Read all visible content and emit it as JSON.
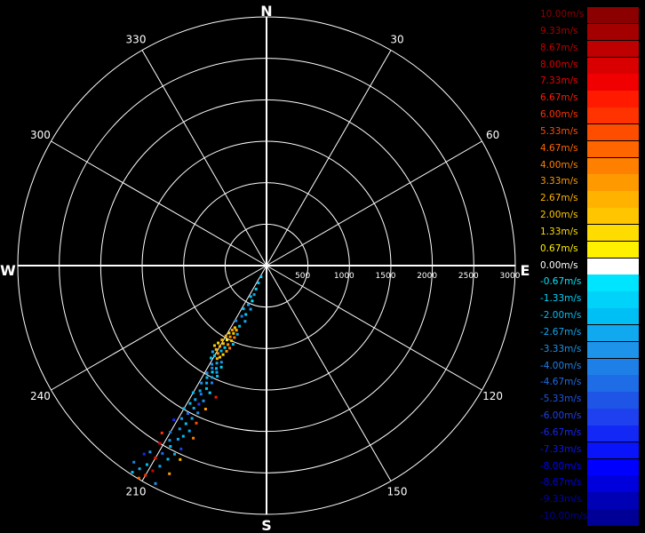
{
  "chart_data": {
    "type": "scatter",
    "projection": "polar",
    "compass": {
      "north": "N",
      "east": "E",
      "south": "S",
      "west": "W"
    },
    "angle_labels": [
      "30",
      "60",
      "120",
      "150",
      "210",
      "240",
      "300",
      "330"
    ],
    "range_labels": [
      "500",
      "1000",
      "1500",
      "2000",
      "2500",
      "3000"
    ],
    "range_max": 3000,
    "grid": true,
    "legend_position": "right",
    "legend": [
      {
        "label": "10.00m/s",
        "value": 10.0,
        "color": "#8b0000"
      },
      {
        "label": "9.33m/s",
        "value": 9.33,
        "color": "#a50000"
      },
      {
        "label": "8.67m/s",
        "value": 8.67,
        "color": "#bf0000"
      },
      {
        "label": "8.00m/s",
        "value": 8.0,
        "color": "#d80000"
      },
      {
        "label": "7.33m/s",
        "value": 7.33,
        "color": "#f00000"
      },
      {
        "label": "6.67m/s",
        "value": 6.67,
        "color": "#ff1a00"
      },
      {
        "label": "6.00m/s",
        "value": 6.0,
        "color": "#ff3300"
      },
      {
        "label": "5.33m/s",
        "value": 5.33,
        "color": "#ff4d00"
      },
      {
        "label": "4.67m/s",
        "value": 4.67,
        "color": "#ff6600"
      },
      {
        "label": "4.00m/s",
        "value": 4.0,
        "color": "#ff7f00"
      },
      {
        "label": "3.33m/s",
        "value": 3.33,
        "color": "#ff9900"
      },
      {
        "label": "2.67m/s",
        "value": 2.67,
        "color": "#ffb300"
      },
      {
        "label": "2.00m/s",
        "value": 2.0,
        "color": "#ffc600"
      },
      {
        "label": "1.33m/s",
        "value": 1.33,
        "color": "#ffdc00"
      },
      {
        "label": "0.67m/s",
        "value": 0.67,
        "color": "#fff000"
      },
      {
        "label": "0.00m/s",
        "value": 0.0,
        "color": "#ffffff"
      },
      {
        "label": "-0.67m/s",
        "value": -0.67,
        "color": "#00e5ff"
      },
      {
        "label": "-1.33m/s",
        "value": -1.33,
        "color": "#00d2fa"
      },
      {
        "label": "-2.00m/s",
        "value": -2.0,
        "color": "#00bff5"
      },
      {
        "label": "-2.67m/s",
        "value": -2.67,
        "color": "#10a8ef"
      },
      {
        "label": "-3.33m/s",
        "value": -3.33,
        "color": "#1d93ea"
      },
      {
        "label": "-4.00m/s",
        "value": -4.0,
        "color": "#1e80e6"
      },
      {
        "label": "-4.67m/s",
        "value": -4.67,
        "color": "#1e6ce6"
      },
      {
        "label": "-5.33m/s",
        "value": -5.33,
        "color": "#1e55e6"
      },
      {
        "label": "-6.00m/s",
        "value": -6.0,
        "color": "#1e40ee"
      },
      {
        "label": "-6.67m/s",
        "value": -6.67,
        "color": "#1428f5"
      },
      {
        "label": "-7.33m/s",
        "value": -7.33,
        "color": "#0a14fa"
      },
      {
        "label": "-8.00m/s",
        "value": -8.0,
        "color": "#0000ff"
      },
      {
        "label": "-8.67m/s",
        "value": -8.67,
        "color": "#0000dc"
      },
      {
        "label": "-9.33m/s",
        "value": -9.33,
        "color": "#0000b4"
      },
      {
        "label": "-10.00m/s",
        "value": -10.0,
        "color": "#000096"
      }
    ],
    "points": [
      {
        "azimuth": 206,
        "range": 150,
        "velocity": -1.3
      },
      {
        "azimuth": 205,
        "range": 230,
        "velocity": -2.0
      },
      {
        "azimuth": 204,
        "range": 310,
        "velocity": -1.3
      },
      {
        "azimuth": 203,
        "range": 380,
        "velocity": -2.7
      },
      {
        "azimuth": 207,
        "range": 420,
        "velocity": -2.0
      },
      {
        "azimuth": 202,
        "range": 460,
        "velocity": -0.7
      },
      {
        "azimuth": 205,
        "range": 520,
        "velocity": -3.3
      },
      {
        "azimuth": 200,
        "range": 560,
        "velocity": -2.7
      },
      {
        "azimuth": 208,
        "range": 590,
        "velocity": -2.0
      },
      {
        "azimuth": 203,
        "range": 640,
        "velocity": -1.3
      },
      {
        "azimuth": 206,
        "range": 680,
        "velocity": -4.0
      },
      {
        "azimuth": 201,
        "range": 720,
        "velocity": -2.7
      },
      {
        "azimuth": 209,
        "range": 760,
        "velocity": -3.3
      },
      {
        "azimuth": 204,
        "range": 800,
        "velocity": -2.0
      },
      {
        "azimuth": 207,
        "range": 840,
        "velocity": 2.0
      },
      {
        "azimuth": 205,
        "range": 860,
        "velocity": 2.7
      },
      {
        "azimuth": 208,
        "range": 880,
        "velocity": 3.3
      },
      {
        "azimuth": 203,
        "range": 900,
        "velocity": -2.7
      },
      {
        "azimuth": 206,
        "range": 910,
        "velocity": 2.0
      },
      {
        "azimuth": 209,
        "range": 930,
        "velocity": 1.3
      },
      {
        "azimuth": 204,
        "range": 950,
        "velocity": 4.0
      },
      {
        "azimuth": 207,
        "range": 965,
        "velocity": 3.3
      },
      {
        "azimuth": 210,
        "range": 980,
        "velocity": 2.7
      },
      {
        "azimuth": 205,
        "range": 1000,
        "velocity": 2.0
      },
      {
        "azimuth": 208,
        "range": 1015,
        "velocity": 0.7
      },
      {
        "azimuth": 203,
        "range": 1030,
        "velocity": -2.0
      },
      {
        "azimuth": 211,
        "range": 1045,
        "velocity": 2.7
      },
      {
        "azimuth": 206,
        "range": 1060,
        "velocity": 3.3
      },
      {
        "azimuth": 209,
        "range": 1075,
        "velocity": 2.0
      },
      {
        "azimuth": 204,
        "range": 1090,
        "velocity": 4.0
      },
      {
        "azimuth": 212,
        "range": 1100,
        "velocity": 1.3
      },
      {
        "azimuth": 207,
        "range": 1110,
        "velocity": -1.3
      },
      {
        "azimuth": 210,
        "range": 1125,
        "velocity": 2.7
      },
      {
        "azimuth": 205,
        "range": 1140,
        "velocity": 3.3
      },
      {
        "azimuth": 213,
        "range": 1150,
        "velocity": 2.0
      },
      {
        "azimuth": 208,
        "range": 1165,
        "velocity": -2.0
      },
      {
        "azimuth": 211,
        "range": 1180,
        "velocity": 2.7
      },
      {
        "azimuth": 206,
        "range": 1195,
        "velocity": 1.3
      },
      {
        "azimuth": 209,
        "range": 1210,
        "velocity": 3.3
      },
      {
        "azimuth": 212,
        "range": 1225,
        "velocity": -2.7
      },
      {
        "azimuth": 207,
        "range": 1240,
        "velocity": 2.0
      },
      {
        "azimuth": 210,
        "range": 1255,
        "velocity": -1.3
      },
      {
        "azimuth": 208,
        "range": 1270,
        "velocity": 2.7
      },
      {
        "azimuth": 205,
        "range": 1285,
        "velocity": -3.3
      },
      {
        "azimuth": 211,
        "range": 1300,
        "velocity": -2.0
      },
      {
        "azimuth": 207,
        "range": 1320,
        "velocity": -2.7
      },
      {
        "azimuth": 204,
        "range": 1340,
        "velocity": -1.3
      },
      {
        "azimuth": 209,
        "range": 1360,
        "velocity": -3.3
      },
      {
        "azimuth": 206,
        "range": 1380,
        "velocity": -2.0
      },
      {
        "azimuth": 208,
        "range": 1400,
        "velocity": -4.0
      },
      {
        "azimuth": 205,
        "range": 1420,
        "velocity": -2.7
      },
      {
        "azimuth": 207,
        "range": 1440,
        "velocity": -1.3
      },
      {
        "azimuth": 204,
        "range": 1460,
        "velocity": -2.0
      },
      {
        "azimuth": 209,
        "range": 1480,
        "velocity": -3.3
      },
      {
        "azimuth": 206,
        "range": 1500,
        "velocity": -2.7
      },
      {
        "azimuth": 208,
        "range": 1530,
        "velocity": -2.0
      },
      {
        "azimuth": 205,
        "range": 1560,
        "velocity": -4.0
      },
      {
        "azimuth": 207,
        "range": 1590,
        "velocity": -2.7
      },
      {
        "azimuth": 209,
        "range": 1620,
        "velocity": -3.3
      },
      {
        "azimuth": 206,
        "range": 1650,
        "velocity": -2.0
      },
      {
        "azimuth": 204,
        "range": 1680,
        "velocity": -1.3
      },
      {
        "azimuth": 208,
        "range": 1710,
        "velocity": -2.7
      },
      {
        "azimuth": 201,
        "range": 1700,
        "velocity": 6.7
      },
      {
        "azimuth": 207,
        "range": 1740,
        "velocity": -4.0
      },
      {
        "azimuth": 210,
        "range": 1770,
        "velocity": -2.0
      },
      {
        "azimuth": 205,
        "range": 1800,
        "velocity": -3.3
      },
      {
        "azimuth": 208,
        "range": 1830,
        "velocity": -2.7
      },
      {
        "azimuth": 206,
        "range": 1860,
        "velocity": -6.0
      },
      {
        "azimuth": 203,
        "range": 1880,
        "velocity": 3.3
      },
      {
        "azimuth": 209,
        "range": 1900,
        "velocity": -2.0
      },
      {
        "azimuth": 207,
        "range": 1930,
        "velocity": -2.7
      },
      {
        "azimuth": 205,
        "range": 1960,
        "velocity": -3.3
      },
      {
        "azimuth": 210,
        "range": 1990,
        "velocity": -2.0
      },
      {
        "azimuth": 208,
        "range": 2020,
        "velocity": -4.7
      },
      {
        "azimuth": 206,
        "range": 2050,
        "velocity": -2.7
      },
      {
        "azimuth": 204,
        "range": 2080,
        "velocity": 5.3
      },
      {
        "azimuth": 209,
        "range": 2110,
        "velocity": -3.3
      },
      {
        "azimuth": 207,
        "range": 2140,
        "velocity": -2.0
      },
      {
        "azimuth": 211,
        "range": 2170,
        "velocity": -6.7
      },
      {
        "azimuth": 205,
        "range": 2200,
        "velocity": -2.7
      },
      {
        "azimuth": 208,
        "range": 2230,
        "velocity": -3.3
      },
      {
        "azimuth": 203,
        "range": 2260,
        "velocity": 4.0
      },
      {
        "azimuth": 206,
        "range": 2290,
        "velocity": -2.0
      },
      {
        "azimuth": 210,
        "range": 2320,
        "velocity": -4.0
      },
      {
        "azimuth": 207,
        "range": 2350,
        "velocity": -2.7
      },
      {
        "azimuth": 212,
        "range": 2380,
        "velocity": 6.0
      },
      {
        "azimuth": 209,
        "range": 2410,
        "velocity": -3.3
      },
      {
        "azimuth": 205,
        "range": 2440,
        "velocity": -6.0
      },
      {
        "azimuth": 208,
        "range": 2470,
        "velocity": -2.0
      },
      {
        "azimuth": 211,
        "range": 2500,
        "velocity": 7.3
      },
      {
        "azimuth": 206,
        "range": 2530,
        "velocity": -2.7
      },
      {
        "azimuth": 204,
        "range": 2560,
        "velocity": 2.7
      },
      {
        "azimuth": 209,
        "range": 2590,
        "velocity": -4.7
      },
      {
        "azimuth": 207,
        "range": 2620,
        "velocity": -2.0
      },
      {
        "azimuth": 212,
        "range": 2650,
        "velocity": -3.3
      },
      {
        "azimuth": 210,
        "range": 2680,
        "velocity": 6.7
      },
      {
        "azimuth": 213,
        "range": 2710,
        "velocity": -6.7
      },
      {
        "azimuth": 208,
        "range": 2740,
        "velocity": -2.7
      },
      {
        "azimuth": 205,
        "range": 2770,
        "velocity": 3.3
      },
      {
        "azimuth": 211,
        "range": 2800,
        "velocity": -2.0
      },
      {
        "azimuth": 209,
        "range": 2830,
        "velocity": 8.0
      },
      {
        "azimuth": 214,
        "range": 2860,
        "velocity": -4.0
      },
      {
        "azimuth": 212,
        "range": 2890,
        "velocity": -2.7
      },
      {
        "azimuth": 210,
        "range": 2920,
        "velocity": 6.0
      },
      {
        "azimuth": 207,
        "range": 2950,
        "velocity": -3.3
      },
      {
        "azimuth": 213,
        "range": 2970,
        "velocity": -2.0
      },
      {
        "azimuth": 211,
        "range": 2990,
        "velocity": 4.7
      }
    ]
  }
}
